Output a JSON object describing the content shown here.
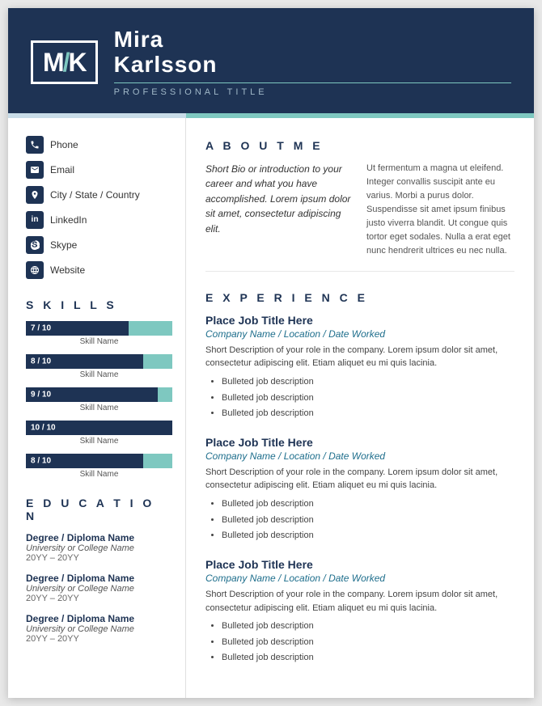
{
  "header": {
    "logo": "M/K",
    "first_name": "Mira",
    "last_name": "Karlsson",
    "title": "PROFESSIONAL TITLE"
  },
  "contact": {
    "items": [
      {
        "icon": "📞",
        "label": "Phone",
        "icon_name": "phone-icon"
      },
      {
        "icon": "✉",
        "label": "Email",
        "icon_name": "email-icon"
      },
      {
        "icon": "📍",
        "label": "City / State / Country",
        "icon_name": "location-icon"
      },
      {
        "icon": "in",
        "label": "LinkedIn",
        "icon_name": "linkedin-icon"
      },
      {
        "icon": "S",
        "label": "Skype",
        "icon_name": "skype-icon"
      },
      {
        "icon": "🔗",
        "label": "Website",
        "icon_name": "website-icon"
      }
    ]
  },
  "skills": {
    "section_title": "S K I L L S",
    "items": [
      {
        "name": "Skill Name",
        "score": 7,
        "max": 10,
        "label": "7 / 10"
      },
      {
        "name": "Skill Name",
        "score": 8,
        "max": 10,
        "label": "8 / 10"
      },
      {
        "name": "Skill Name",
        "score": 9,
        "max": 10,
        "label": "9 / 10"
      },
      {
        "name": "Skill Name",
        "score": 10,
        "max": 10,
        "label": "10 / 10"
      },
      {
        "name": "Skill Name",
        "score": 8,
        "max": 10,
        "label": "8 / 10"
      }
    ]
  },
  "education": {
    "section_title": "E D U C A T I O N",
    "items": [
      {
        "degree": "Degree / Diploma Name",
        "school": "University or College Name",
        "dates": "20YY – 20YY"
      },
      {
        "degree": "Degree / Diploma Name",
        "school": "University or College Name",
        "dates": "20YY – 20YY"
      },
      {
        "degree": "Degree / Diploma Name",
        "school": "University or College Name",
        "dates": "20YY – 20YY"
      }
    ]
  },
  "about": {
    "section_title": "A B O U T  M E",
    "bio": "Short Bio or introduction to your career and what you have accomplished. Lorem ipsum dolor sit amet, consectetur adipiscing elit.",
    "extra": "Ut fermentum a magna ut eleifend. Integer convallis suscipit ante eu varius. Morbi a purus dolor. Suspendisse sit amet ipsum finibus justo viverra blandit. Ut congue quis tortor eget sodales. Nulla a erat eget nunc hendrerit ultrices eu nec nulla."
  },
  "experience": {
    "section_title": "E X P E R I E N C E",
    "jobs": [
      {
        "title": "Place Job Title Here",
        "company": "Company Name / Location / Date Worked",
        "description": "Short Description of your role in the company. Lorem ipsum dolor sit amet, consectetur adipiscing elit. Etiam aliquet eu mi quis lacinia.",
        "bullets": [
          "Bulleted job description",
          "Bulleted job description",
          "Bulleted job description"
        ]
      },
      {
        "title": "Place Job Title Here",
        "company": "Company Name / Location / Date Worked",
        "description": "Short Description of your role in the company. Lorem ipsum dolor sit amet, consectetur adipiscing elit. Etiam aliquet eu mi quis lacinia.",
        "bullets": [
          "Bulleted job description",
          "Bulleted job description",
          "Bulleted job description"
        ]
      },
      {
        "title": "Place Job Title Here",
        "company": "Company Name / Location / Date Worked",
        "description": "Short Description of your role in the company. Lorem ipsum dolor sit amet, consectetur adipiscing elit. Etiam aliquet eu mi quis lacinia.",
        "bullets": [
          "Bulleted job description",
          "Bulleted job description",
          "Bulleted job description"
        ]
      }
    ]
  }
}
